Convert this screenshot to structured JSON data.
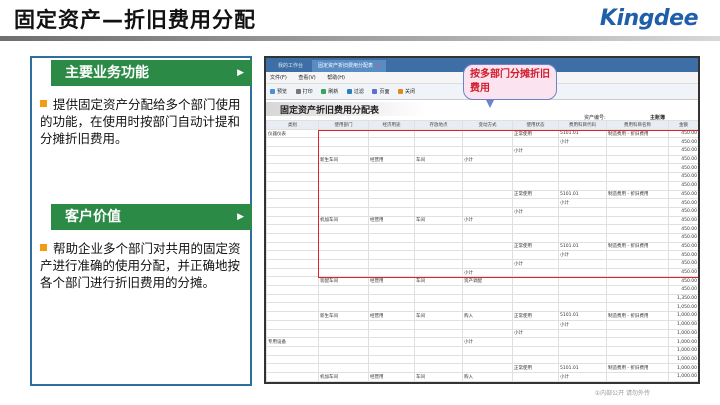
{
  "slide": {
    "title": "固定资产—折旧费用分配",
    "logo": "Kingdee",
    "footnote": "①内部公开 请勿外传"
  },
  "panel": {
    "section1": {
      "heading": "主要业务功能",
      "body": "提供固定资产分配给多个部门使用的功能，在使用时按部门自动计提和分摊折旧费用。"
    },
    "section2": {
      "heading": "客户价值",
      "body": "帮助企业多个部门对共用的固定资产进行准确的使用分配，并正确地按各个部门进行折旧费用的分摊。"
    }
  },
  "app": {
    "tabs": [
      "我的工作台",
      "固定资产折旧费用分配表"
    ],
    "menu": [
      "文件(F)",
      "查看(V)",
      "帮助(H)"
    ],
    "toolbar": [
      "预览",
      "打印",
      "刷新",
      "过滤",
      "页面",
      "关闭"
    ],
    "report_title": "固定资产折旧费用分配表",
    "meta": {
      "label": "资产编号:",
      "value": "",
      "book_label": "主账簿"
    },
    "callout": "按多部门分摊折旧费用",
    "columns": [
      "类别",
      "使用部门",
      "经济用途",
      "存放地点",
      "变动方式",
      "使用状态",
      "费用科目代码",
      "费用科目名称",
      "金额"
    ],
    "rows": [
      [
        "",
        "",
        "",
        "",
        "",
        "正常使用",
        "5101.01",
        "制造费用 - 折旧费用",
        "450.00"
      ],
      [
        "",
        "",
        "",
        "",
        "",
        "",
        "小计",
        "",
        "450.00"
      ],
      [
        "",
        "",
        "",
        "",
        "",
        "小计",
        "",
        "",
        "450.00"
      ],
      [
        "",
        "",
        "",
        "",
        "小计",
        "",
        "",
        "",
        "450.00"
      ],
      [
        "",
        "",
        "",
        "",
        "",
        "",
        "",
        "",
        "450.00"
      ],
      [
        "",
        "",
        "",
        "",
        "",
        "",
        "",
        "",
        "450.00"
      ],
      [
        "",
        "",
        "",
        "",
        "",
        "",
        "",
        "",
        "450.00"
      ],
      [
        "",
        "",
        "",
        "",
        "",
        "正常使用",
        "5101.01",
        "制造费用 - 折旧费用",
        "450.00"
      ],
      [
        "",
        "",
        "",
        "",
        "",
        "",
        "小计",
        "",
        "450.00"
      ],
      [
        "",
        "",
        "",
        "",
        "",
        "小计",
        "",
        "",
        "450.00"
      ],
      [
        "",
        "",
        "",
        "",
        "小计",
        "",
        "",
        "",
        "450.00"
      ],
      [
        "",
        "",
        "",
        "",
        "",
        "",
        "",
        "",
        "450.00"
      ],
      [
        "",
        "",
        "",
        "",
        "",
        "",
        "",
        "",
        "450.00"
      ],
      [
        "",
        "",
        "",
        "",
        "",
        "正常使用",
        "5101.01",
        "制造费用 - 折旧费用",
        "450.00"
      ],
      [
        "",
        "",
        "",
        "",
        "",
        "",
        "小计",
        "",
        "450.00"
      ],
      [
        "",
        "",
        "",
        "",
        "",
        "小计",
        "",
        "",
        "450.00"
      ],
      [
        "",
        "",
        "",
        "",
        "小计",
        "",
        "",
        "",
        "450.00"
      ],
      [
        "",
        "",
        "",
        "",
        "",
        "",
        "",
        "",
        "450.00"
      ],
      [
        "",
        "",
        "",
        "",
        "",
        "",
        "",
        "",
        "450.00"
      ],
      [
        "",
        "",
        "",
        "",
        "",
        "",
        "",
        "",
        "1,350.00"
      ],
      [
        "",
        "",
        "",
        "",
        "",
        "",
        "",
        "",
        "1,050.00"
      ],
      [
        "",
        "",
        "",
        "",
        "",
        "正常使用",
        "5101.01",
        "制造费用 - 折旧费用",
        "1,000.00"
      ],
      [
        "",
        "",
        "",
        "",
        "",
        "",
        "小计",
        "",
        "1,000.00"
      ],
      [
        "",
        "",
        "",
        "",
        "",
        "小计",
        "",
        "",
        "1,000.00"
      ],
      [
        "",
        "",
        "",
        "",
        "小计",
        "",
        "",
        "",
        "1,000.00"
      ],
      [
        "",
        "",
        "",
        "",
        "",
        "",
        "",
        "",
        "1,000.00"
      ],
      [
        "",
        "",
        "",
        "",
        "",
        "",
        "",
        "",
        "1,000.00"
      ],
      [
        "",
        "",
        "",
        "",
        "",
        "正常使用",
        "5101.01",
        "制造费用 - 折旧费用",
        "1,000.00"
      ],
      [
        "",
        "",
        "",
        "",
        "",
        "",
        "小计",
        "",
        "1,000.00"
      ],
      [
        "",
        "",
        "",
        "",
        "",
        "小计",
        "",
        "",
        "1,000.00"
      ],
      [
        "",
        "",
        "",
        "",
        "小计",
        "",
        "",
        "",
        "1,000.00"
      ],
      [
        "",
        "",
        "",
        "",
        "",
        "",
        "",
        "",
        "1,000.00"
      ]
    ],
    "labels": {
      "cat1": "仪器仪表",
      "cat2": "专用设备",
      "dept1": "新生车间",
      "dept2": "机加车间",
      "dept3": "装配车间",
      "use": "经营用",
      "loc": "车间",
      "chg1": "购入",
      "chg2": "资产调配",
      "subtotal": "小计"
    }
  }
}
